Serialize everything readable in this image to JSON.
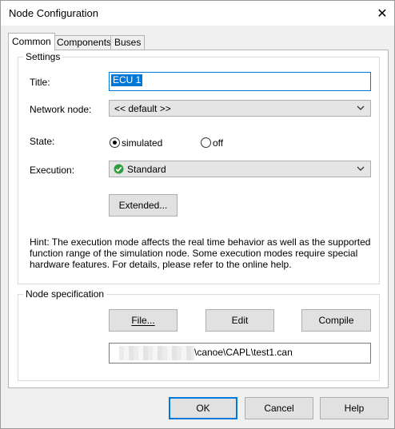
{
  "window": {
    "title": "Node Configuration",
    "close_glyph": "✕"
  },
  "tabs": [
    {
      "label": "Common",
      "active": true
    },
    {
      "label": "Components",
      "active": false
    },
    {
      "label": "Buses",
      "active": false
    }
  ],
  "settings": {
    "legend": "Settings",
    "title_label": "Title:",
    "title_value": "ECU 1",
    "network_node_label": "Network node:",
    "network_node_value": "<< default >>",
    "state_label": "State:",
    "state_options": [
      {
        "label": "simulated",
        "checked": true
      },
      {
        "label": "off",
        "checked": false
      }
    ],
    "execution_label": "Execution:",
    "execution_value": "Standard",
    "extended_button": "Extended...",
    "hint": "Hint: The execution mode affects the real time behavior as well as the supported function range of the simulation node. Some execution modes require special hardware features. For details, please refer to the online help."
  },
  "node_spec": {
    "legend": "Node specification",
    "file_button": "File...",
    "edit_button": "Edit",
    "compile_button": "Compile",
    "file_path_visible": "\\canoe\\CAPL\\test1.can"
  },
  "footer": {
    "ok": "OK",
    "cancel": "Cancel",
    "help": "Help"
  },
  "colors": {
    "accent": "#0078d7",
    "check_green": "#2e9e3e"
  },
  "icons": {
    "execution": "green-check-icon",
    "dropdown": "chevron-down-icon",
    "close": "close-icon"
  }
}
